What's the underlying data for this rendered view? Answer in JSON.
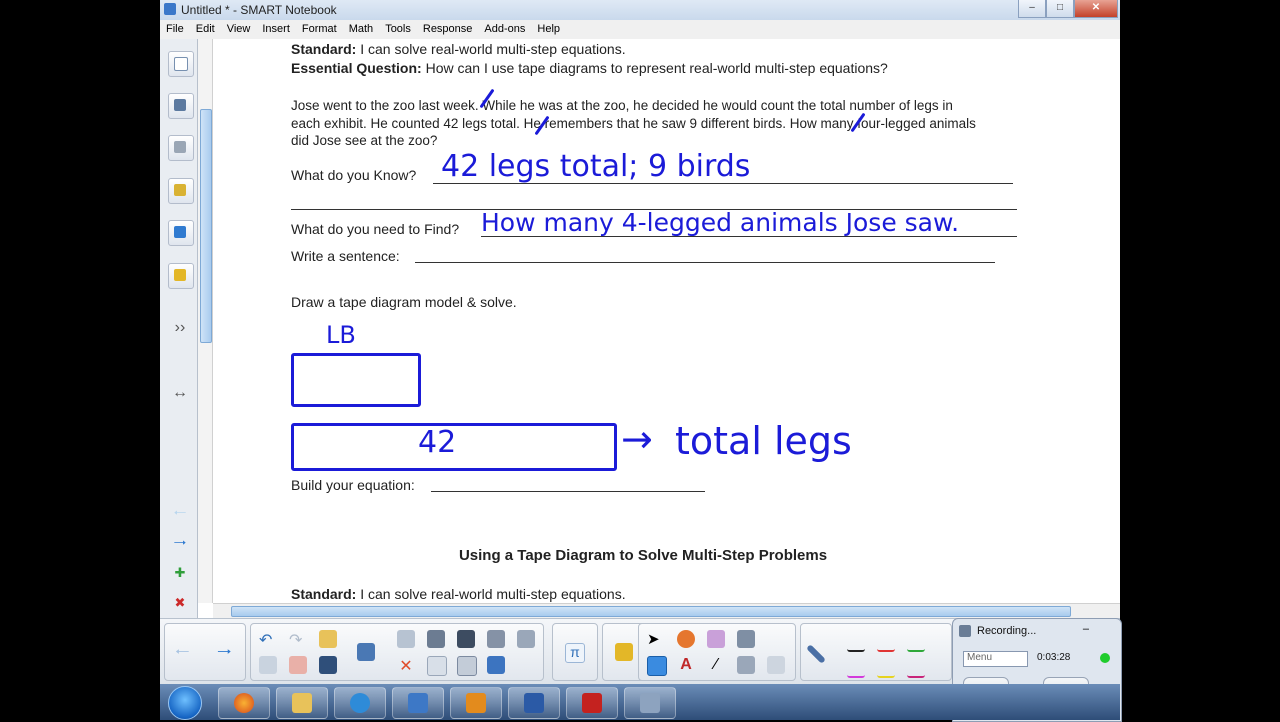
{
  "window": {
    "title": "Untitled * - SMART Notebook"
  },
  "menubar": [
    "File",
    "Edit",
    "View",
    "Insert",
    "Format",
    "Math",
    "Tools",
    "Response",
    "Add-ons",
    "Help"
  ],
  "page": {
    "standard_label": "Standard:",
    "standard_text": " I can solve real-world multi-step equations.",
    "eq_label": "Essential Question:",
    "eq_text": " How can I use tape diagrams to represent real-world multi-step equations?",
    "problem_line1": "Jose went to the zoo last week. While he was at the zoo, he decided he would count the total number of legs in",
    "problem_line2": "each exhibit. He counted 42 legs total. He remembers that he saw 9 different birds. How many four-legged animals",
    "problem_line3": "did Jose see at the zoo?",
    "know_label": "What do you Know?",
    "know_answer": "42 legs total; 9 birds",
    "find_label": "What do you need to Find?",
    "find_answer": "How many 4-legged animals Jose saw.",
    "sentence_label": "Write a sentence:",
    "draw_label": "Draw a tape diagram model & solve.",
    "tape_top_label": "LB",
    "tape_bottom_value": "42",
    "tape_arrow_label": "total legs",
    "equation_label": "Build your equation:",
    "next_title": "Using a Tape Diagram to Solve Multi-Step Problems",
    "next_standard_label": "Standard:",
    "next_standard_text": " I can solve real-world multi-step equations."
  },
  "recording": {
    "title": "Recording...",
    "menu": "Menu",
    "time": "0:03:28"
  },
  "colors": {
    "ink": "#1b1bd8",
    "titlebar": "#c9d9ec",
    "taskbar": "#2e4d78"
  }
}
